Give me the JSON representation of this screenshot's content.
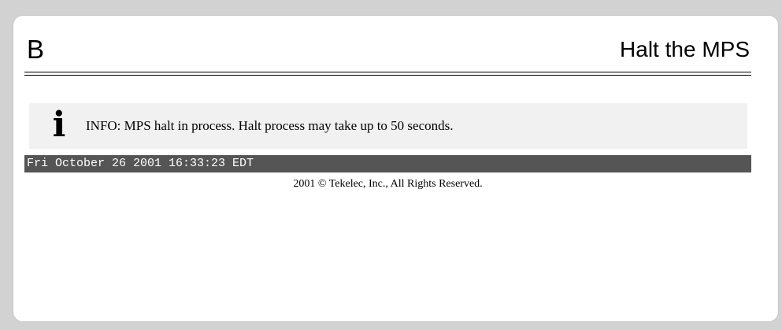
{
  "header": {
    "letter": "B",
    "title": "Halt the MPS"
  },
  "info": {
    "icon": "info-icon",
    "icon_glyph": "i",
    "message": "INFO: MPS halt in process. Halt process may take up to 50 seconds."
  },
  "status_bar": {
    "timestamp": "Fri October 26 2001 16:33:23 EDT"
  },
  "footer": {
    "copyright": "2001 © Tekelec, Inc., All Rights Reserved."
  },
  "colors": {
    "page_background": "#d2d2d2",
    "panel_background": "#ffffff",
    "info_background": "#f1f1f1",
    "status_bar_background": "#555555",
    "status_bar_text": "#ffffff"
  }
}
